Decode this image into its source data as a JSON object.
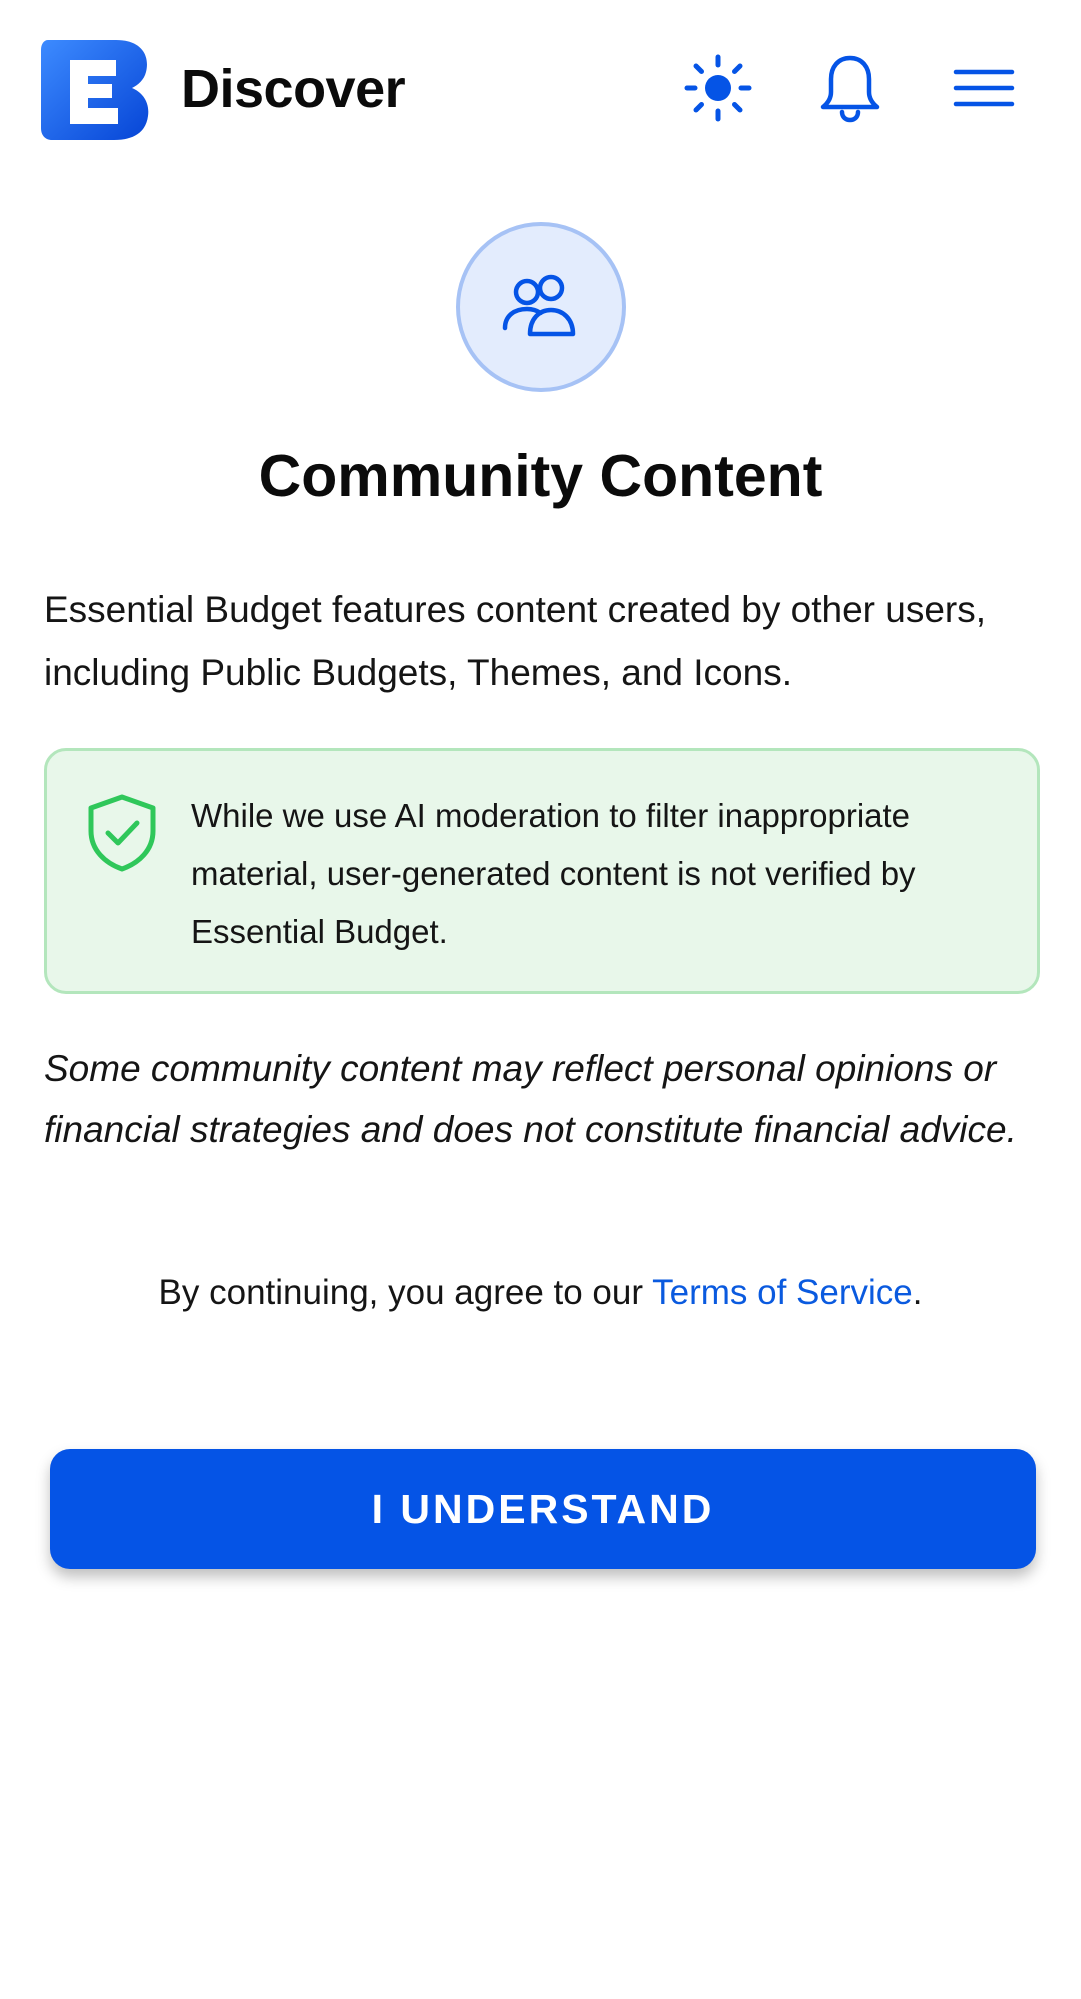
{
  "header": {
    "title": "Discover",
    "logo_icon": "essential-budget-logo-icon",
    "theme_icon": "sun-icon",
    "notifications_icon": "bell-icon",
    "menu_icon": "hamburger-menu-icon"
  },
  "content": {
    "community_icon": "users-icon",
    "title": "Community Content",
    "intro": "Essential Budget features content created by other users, including Public Budgets, Themes, and Icons.",
    "notice": {
      "icon": "shield-check-icon",
      "text": "While we use AI moderation to filter inappropriate material, user-generated content is not verified by Essential Budget."
    },
    "disclaimer": "Some community content may reflect personal opinions or financial strategies and does not constitute financial advice.",
    "agreement": {
      "prefix": "By continuing, you agree to our ",
      "link_label": "Terms of Service",
      "suffix": "."
    },
    "button_label": "I UNDERSTAND"
  },
  "colors": {
    "accent": "#0554e6",
    "link": "#0a5adf",
    "notice_background": "#e8f7ea",
    "notice_border": "#b3e6bc",
    "shield": "#2fc75a",
    "circle_background": "#e3ecfd",
    "circle_border": "#a6c2f5"
  }
}
